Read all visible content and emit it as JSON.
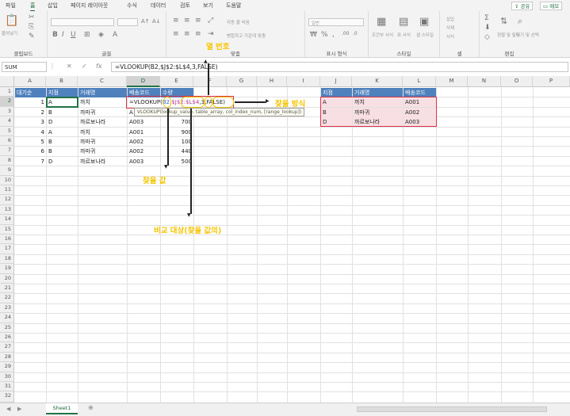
{
  "ribbon_tabs": [
    "파일",
    "홈",
    "삽입",
    "페이지 레이아웃",
    "수식",
    "데이터",
    "검토",
    "보기",
    "도움말"
  ],
  "active_tab": "홈",
  "share_label": "공유",
  "comment_label": "메모",
  "ribbon_groups": {
    "clipboard": "클립보드",
    "font": "글꼴",
    "alignment": "맞춤",
    "number": "표시 형식",
    "styles": "스타일",
    "cells": "셀",
    "editing": "편집"
  },
  "ribbon_misc": {
    "paste": "붙여넣기",
    "wrap_text": "자동 줄 바꿈",
    "merge_center": "병합하고 가운데 맞춤",
    "number_format": "일반",
    "conditional_format": "조건부 서식",
    "table_format": "표 서식",
    "cell_style": "셀 스타일",
    "insert": "삽입",
    "delete": "삭제",
    "format": "서식",
    "sort_filter": "정렬 및 필터",
    "find_select": "찾기 및 선택"
  },
  "name_box": "SUM",
  "formula_bar": "=VLOOKUP(B2,$J$2:$L$4,3,FALSE)",
  "columns": [
    "A",
    "B",
    "C",
    "D",
    "E",
    "F",
    "G",
    "H",
    "I",
    "J",
    "K",
    "L",
    "M",
    "N",
    "O",
    "P"
  ],
  "rows": [
    "1",
    "2",
    "3",
    "4",
    "5",
    "6",
    "7",
    "8",
    "9",
    "10",
    "11",
    "12",
    "13",
    "14",
    "15",
    "16",
    "17",
    "18",
    "19",
    "20",
    "21",
    "22",
    "23",
    "24",
    "25",
    "26",
    "27",
    "28",
    "29",
    "30",
    "31",
    "32"
  ],
  "left_table": {
    "headers": [
      "대기순",
      "지점",
      "거래명",
      "배송코드",
      "수량"
    ],
    "rows": [
      [
        "1",
        "A",
        "까치",
        "",
        ""
      ],
      [
        "2",
        "B",
        "까마귀",
        "A",
        ""
      ],
      [
        "3",
        "D",
        "까르보나라",
        "A003",
        "700"
      ],
      [
        "4",
        "A",
        "까치",
        "A001",
        "900"
      ],
      [
        "5",
        "B",
        "까마귀",
        "A002",
        "100"
      ],
      [
        "6",
        "B",
        "까마귀",
        "A002",
        "440"
      ],
      [
        "7",
        "D",
        "까르보나라",
        "A003",
        "500"
      ]
    ]
  },
  "right_table": {
    "headers": [
      "지점",
      "거래명",
      "배송코드"
    ],
    "rows": [
      [
        "A",
        "까치",
        "A001"
      ],
      [
        "B",
        "까마귀",
        "A002"
      ],
      [
        "D",
        "까르보나라",
        "A003"
      ]
    ]
  },
  "editing_cell": {
    "prefix": "=VLOOKUP(",
    "arg1": "B2",
    "sep1": ",",
    "arg2": "$J$2:$L$4",
    "sep2": ",",
    "arg3": "3",
    "sep3": ",",
    "arg4": "FALSE)"
  },
  "tooltip": "VLOOKUP(lookup_value, table_array, col_index_num, [range_lookup])",
  "annotations": {
    "col_number": "열 번호",
    "match_type": "찾을 방식",
    "lookup_value": "찾을 값",
    "compare_target": "비교 대상(찾을 값의)"
  },
  "sheet_tab": "Sheet1",
  "colors": {
    "excel_green": "#217346",
    "header_blue": "#4f81bd",
    "pink_fill": "#f8dfe3",
    "annotation_yellow": "#f5c400",
    "highlight_red": "#d9334b"
  }
}
